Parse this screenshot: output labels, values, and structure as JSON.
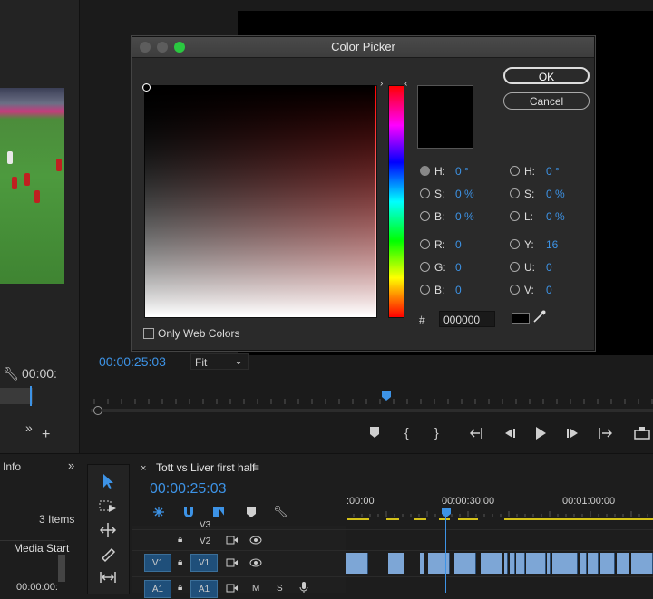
{
  "left_panel": {
    "time": "00:00:",
    "chevrons": "»",
    "plus": "+"
  },
  "program_monitor": {
    "timecode": "00:00:25:03",
    "fit": "Fit",
    "fit_caret": "⌄",
    "controls": [
      "mark-in",
      "{",
      "}",
      "←|",
      "◀|",
      "▶",
      "|▶",
      "→|",
      "⊞"
    ]
  },
  "dialog": {
    "title": "Color Picker",
    "ok": "OK",
    "cancel": "Cancel",
    "hue_arrow_left": "›",
    "hue_arrow_right": "‹",
    "hsb": [
      {
        "label": "H:",
        "value": "0 °",
        "selected": true
      },
      {
        "label": "S:",
        "value": "0 %",
        "selected": false
      },
      {
        "label": "B:",
        "value": "0 %",
        "selected": false
      }
    ],
    "rgb": [
      {
        "label": "R:",
        "value": "0"
      },
      {
        "label": "G:",
        "value": "0"
      },
      {
        "label": "B:",
        "value": "0"
      }
    ],
    "hsl": [
      {
        "label": "H:",
        "value": "0 °"
      },
      {
        "label": "S:",
        "value": "0 %"
      },
      {
        "label": "L:",
        "value": "0 %"
      }
    ],
    "yuv": [
      {
        "label": "Y:",
        "value": "16"
      },
      {
        "label": "U:",
        "value": "0"
      },
      {
        "label": "V:",
        "value": "0"
      }
    ],
    "hash": "#",
    "hex": "000000",
    "only_web_colors": "Only Web Colors"
  },
  "panel": {
    "info_tab": "Info",
    "chevrons": "»",
    "items": "3 Items",
    "media_start": "Media Start",
    "media_start_value": "00:00:00:"
  },
  "timeline": {
    "close": "×",
    "sequence": "Tott vs Liver first half",
    "menu": "≡",
    "timecode": "00:00:25:03",
    "ruler": [
      ":00:00",
      "00:00:30:00",
      "00:01:00:00"
    ],
    "tracks": [
      {
        "name": "V3",
        "src": ""
      },
      {
        "name": "V2",
        "src": ""
      },
      {
        "name": "V1",
        "src": "V1"
      },
      {
        "name": "A1",
        "src": "A1"
      }
    ],
    "a1_m": "M",
    "a1_s": "S"
  },
  "colors": {
    "accent": "#3d93e6",
    "clip": "#7da6d6",
    "selected_color": "#000000"
  }
}
